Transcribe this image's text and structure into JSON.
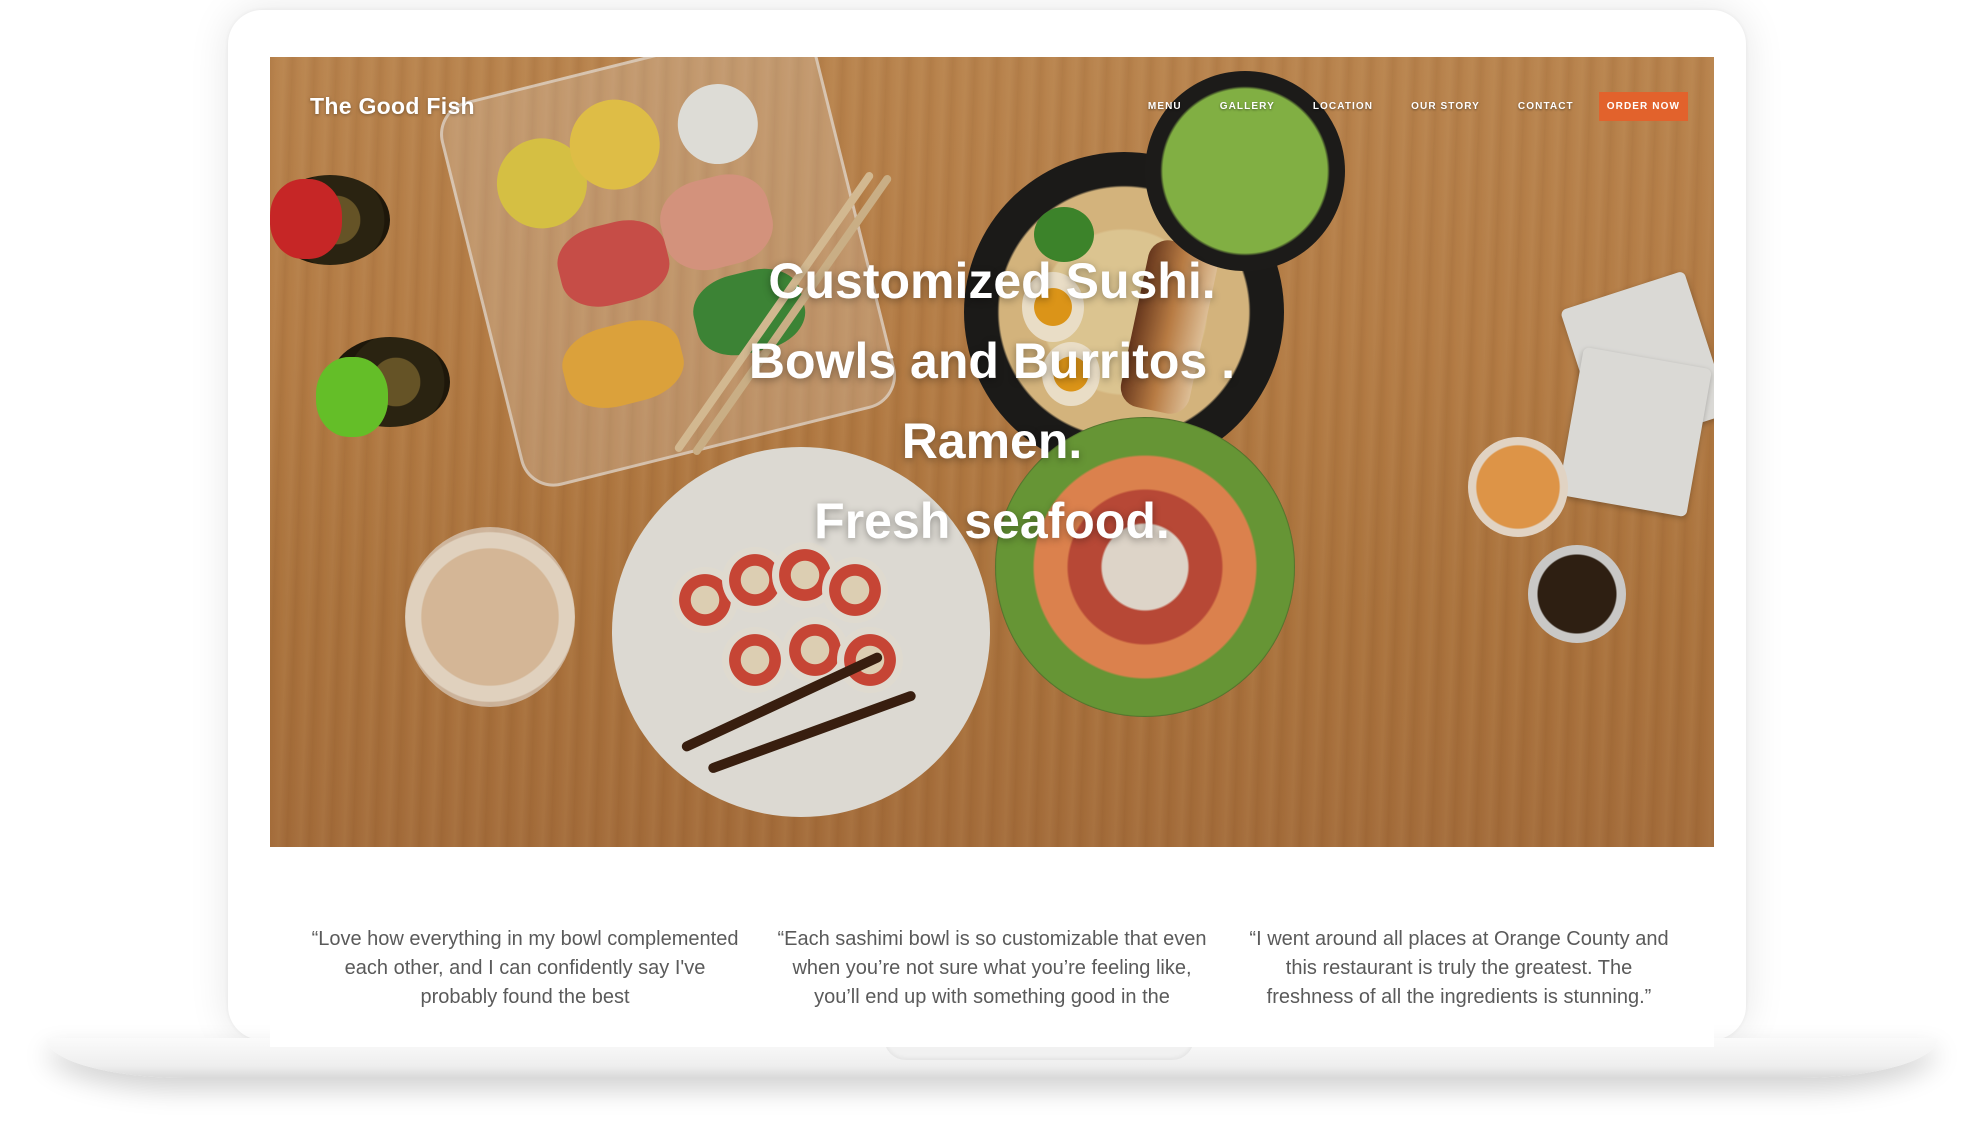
{
  "site": {
    "brand": "The Good Fish",
    "accent_color": "#e2622c"
  },
  "nav": {
    "items": [
      {
        "label": "MENU"
      },
      {
        "label": "GALLERY"
      },
      {
        "label": "LOCATION"
      },
      {
        "label": "OUR STORY"
      },
      {
        "label": "CONTACT"
      }
    ],
    "cta": "ORDER NOW"
  },
  "hero": {
    "lines": [
      "Customized Sushi.",
      "Bowls and Burritos .",
      "Ramen.",
      "Fresh seafood."
    ]
  },
  "testimonials": [
    {
      "quote": "“Love how everything in my bowl complemented each other, and I can confidently say I've probably found the best"
    },
    {
      "quote": "“Each sashimi bowl is so customizable that even when you’re not sure what you’re feeling like, you’ll end up with something good in the"
    },
    {
      "quote": "“I went around all places at Orange County and this restaurant is truly the greatest. The freshness of all the ingredients is stunning.”"
    }
  ]
}
